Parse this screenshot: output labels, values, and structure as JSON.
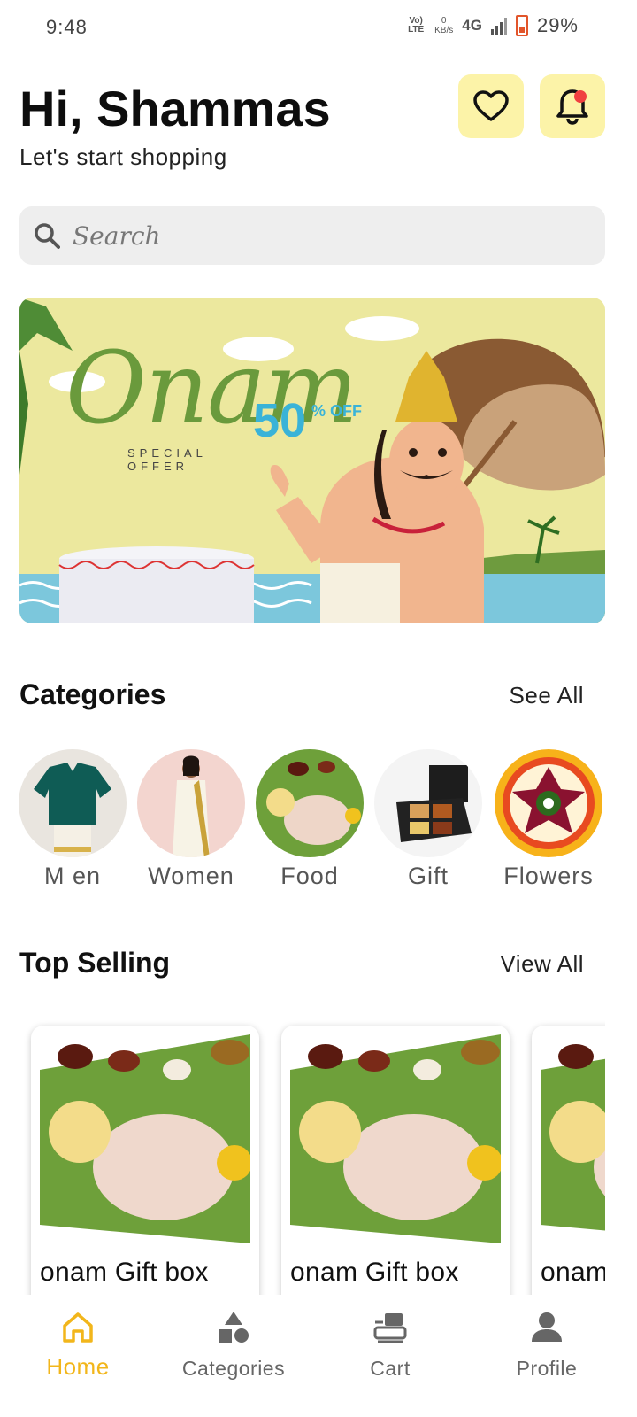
{
  "status_bar": {
    "time": "9:48",
    "volte": "Vo) LTE",
    "kbs_value": "0",
    "kbs_unit": "KB/s",
    "network": "4G",
    "battery": "29%"
  },
  "header": {
    "greeting": "Hi, Shammas",
    "subtitle": "Let's start shopping",
    "favorite_icon": "heart-icon",
    "notification_icon": "bell-icon",
    "notification_dot_color": "#f04040",
    "icon_button_bg": "#fcf3a8"
  },
  "search": {
    "placeholder": "Search"
  },
  "banner": {
    "title": "Onam",
    "discount": "50",
    "discount_suffix": "% OFF",
    "special": "SPECIAL OFFER"
  },
  "categories": {
    "title": "Categories",
    "link": "See All",
    "items": [
      {
        "label": "M      en"
      },
      {
        "label": "Women"
      },
      {
        "label": "Food"
      },
      {
        "label": "Gift"
      },
      {
        "label": "Flowers"
      }
    ]
  },
  "top_selling": {
    "title": "Top Selling",
    "link": "View All",
    "products": [
      {
        "name": "onam Gift box"
      },
      {
        "name": "onam Gift box"
      },
      {
        "name": "onam Gift box"
      }
    ]
  },
  "bottom_nav": {
    "active_color": "#f2b61b",
    "items": [
      {
        "label": "Home",
        "icon": "home-icon"
      },
      {
        "label": "Categories",
        "icon": "categories-icon"
      },
      {
        "label": "Cart",
        "icon": "cart-icon"
      },
      {
        "label": "Profile",
        "icon": "profile-icon"
      }
    ]
  }
}
